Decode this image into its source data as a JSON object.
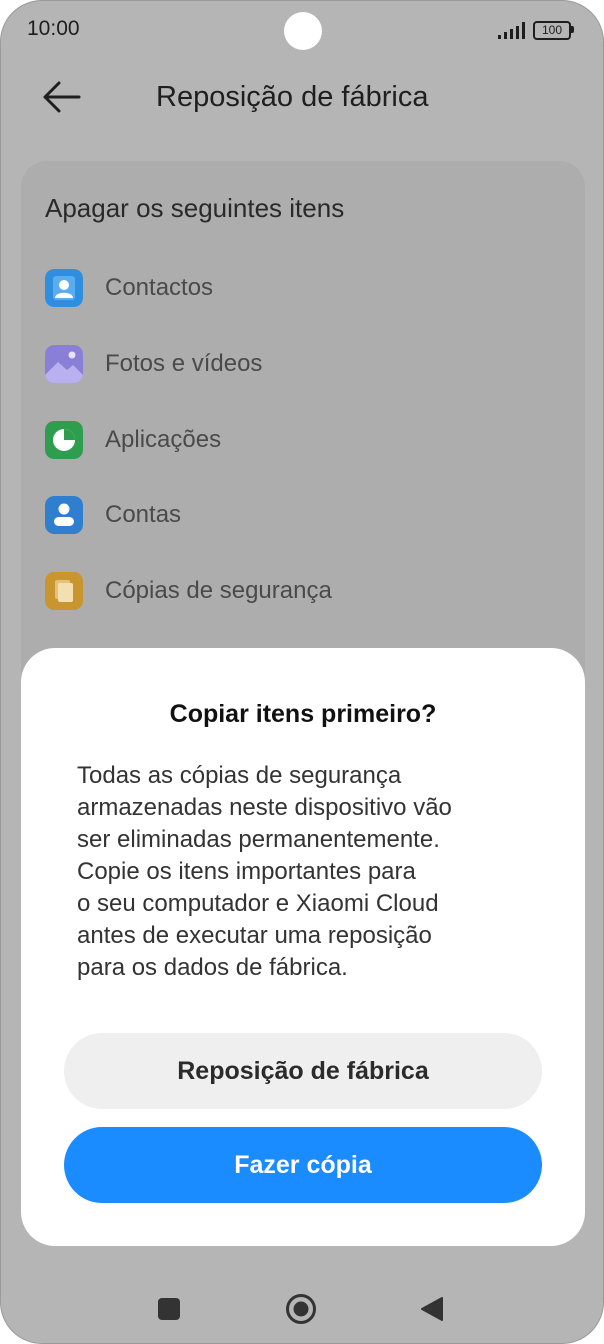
{
  "status_bar": {
    "time": "10:00",
    "battery": "100"
  },
  "header": {
    "title": "Reposição de fábrica",
    "back_icon": "arrow-left-icon"
  },
  "card": {
    "heading": "Apagar os seguintes itens",
    "items": [
      {
        "label": "Contactos",
        "icon": "contacts-icon",
        "color": "#2f8fde"
      },
      {
        "label": "Fotos e vídeos",
        "icon": "gallery-icon",
        "color": "#8a7fd6"
      },
      {
        "label": "Aplicações",
        "icon": "apps-icon",
        "color": "#2e9e4e"
      },
      {
        "label": "Contas",
        "icon": "account-icon",
        "color": "#2f7fd0"
      },
      {
        "label": "Cópias de segurança",
        "icon": "backup-icon",
        "color": "#c9952e"
      }
    ]
  },
  "dialog": {
    "title": "Copiar itens primeiro?",
    "body_lines": [
      "Todas as cópias de segurança",
      "armazenadas neste dispositivo vão",
      "ser eliminadas permanentemente.",
      "Copie os itens importantes para",
      "o seu computador e Xiaomi Cloud",
      "antes de executar uma reposição",
      "para os dados de fábrica."
    ],
    "secondary_button": "Reposição de fábrica",
    "primary_button": "Fazer cópia",
    "primary_color": "#1a8cff"
  },
  "nav_bar": {
    "icons": [
      "recents-square-icon",
      "home-circle-icon",
      "back-triangle-icon"
    ]
  }
}
